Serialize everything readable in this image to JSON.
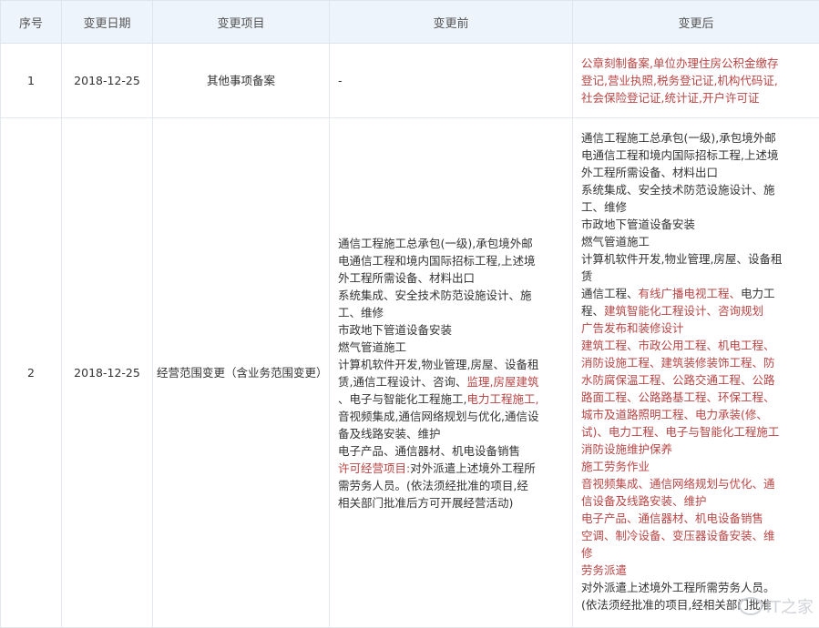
{
  "headers": {
    "seq": "序号",
    "date": "变更日期",
    "item": "变更项目",
    "before": "变更前",
    "after": "变更后"
  },
  "rows": [
    {
      "seq": "1",
      "date": "2018-12-25",
      "item": "其他事项备案",
      "before": "-",
      "after": [
        "公章刻制备案,单位办理住房公积金缴存",
        "登记,营业执照,税务登记证,机构代码证,",
        "社会保险登记证,统计证,开户许可证"
      ]
    },
    {
      "seq": "2",
      "date": "2018-12-25",
      "item": "经营范围变更（含业务范围变更）",
      "before": [
        "通信工程施工总承包(一级),承包境外邮",
        "电通信工程和境内国际招标工程,上述境",
        "外工程所需设备、材料出口",
        "系统集成、安全技术防范设施设计、施",
        "工、维修",
        "市政地下管道设备安装",
        "燃气管道施工",
        "计算机软件开发,物业管理,房屋、设备租",
        "赁,通信工程设计、咨询、",
        "监理,房屋建筑",
        "、电子与智能化工程施工,",
        "电力工程施工,",
        "音视频集成,通信网络规划与优化,通信设",
        "备及线路安装、维护",
        "电子产品、通信器材、机电设备销售",
        "许可经营项目:",
        "对外派遣上述境外工程所",
        "需劳务人员。(依法须经批准的项目,经",
        "相关部门批准后方可开展经营活动)"
      ],
      "after": [
        "通信工程施工总承包(一级),承包境外邮",
        "电通信工程和境内国际招标工程,上述境",
        "外工程所需设备、材料出口",
        "系统集成、安全技术防范设施设计、施",
        "工、维修",
        "市政地下管道设备安装",
        "燃气管道施工",
        "计算机软件开发,物业管理,房屋、设备租",
        "赁",
        "通信工程、",
        "有线广播电视工程、",
        "电力工",
        "程、",
        "建筑智能化工程设计、咨询规划",
        "广告发布和装修设计",
        "建筑工程、市政公用工程、机电工程、",
        "消防设施工程、建筑装修装饰工程、防",
        "水防腐保温工程、公路交通工程、公路",
        "路面工程、公路路基工程、环保工程、",
        "城市及道路照明工程、电力承装(修、",
        "试)、电力工程、电子与智能化工程施工",
        "消防设施维护保养",
        "施工劳务作业",
        "音视频集成、通信网络规划与优化、通",
        "信设备及线路安装、维护",
        "电子产品、通信器材、机电设备销售",
        "空调、制冷设备、变压器设备安装、维",
        "修",
        "劳务派遣",
        "对外派遣上述境外工程所需劳务人员。",
        "(依法须经批准的项目,经相关部门批准"
      ]
    }
  ],
  "watermark": "IT之家",
  "colors": {
    "header_bg": "#eef4fb",
    "border": "#e3e8ee",
    "text": "#333333",
    "highlight_red": "#b84444"
  }
}
